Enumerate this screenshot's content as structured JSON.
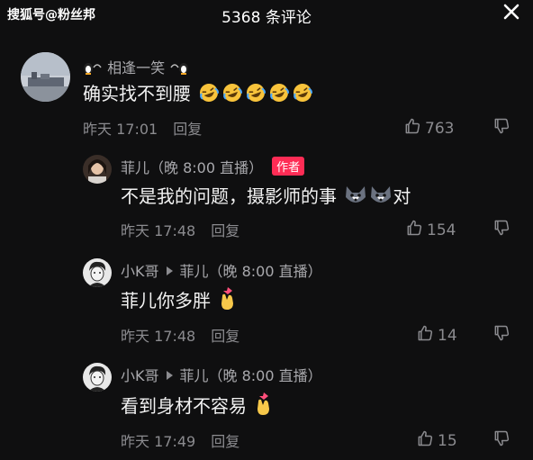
{
  "header": {
    "watermark": "搜狐号@粉丝邦",
    "title": "5368 条评论",
    "close_icon": "close-icon"
  },
  "comments": [
    {
      "name": "相逢一笑",
      "text": "确实找不到腰",
      "emojis": [
        "rofl-emoji",
        "rofl-emoji",
        "rofl-emoji",
        "rofl-emoji",
        "rofl-emoji"
      ],
      "time": "昨天 17:01",
      "reply": "回复",
      "likes": "763"
    }
  ],
  "replies": [
    {
      "name": "菲儿（晚 8:00 直播）",
      "badge": "作者",
      "text": "不是我的问题，摄影师的事",
      "text_tail": "对",
      "time": "昨天 17:48",
      "reply": "回复",
      "likes": "154"
    },
    {
      "name": "小K哥",
      "reply_to": "菲儿（晚 8:00 直播）",
      "text": "菲儿你多胖",
      "time": "昨天 17:48",
      "reply": "回复",
      "likes": "14"
    },
    {
      "name": "小K哥",
      "reply_to": "菲儿（晚 8:00 直播）",
      "text": "看到身材不容易",
      "time": "昨天 17:49",
      "reply": "回复",
      "likes": "15"
    }
  ],
  "colors": {
    "background": "#0f0f10",
    "author_badge": "#fe2c55",
    "muted_text": "#8b8b8f"
  }
}
